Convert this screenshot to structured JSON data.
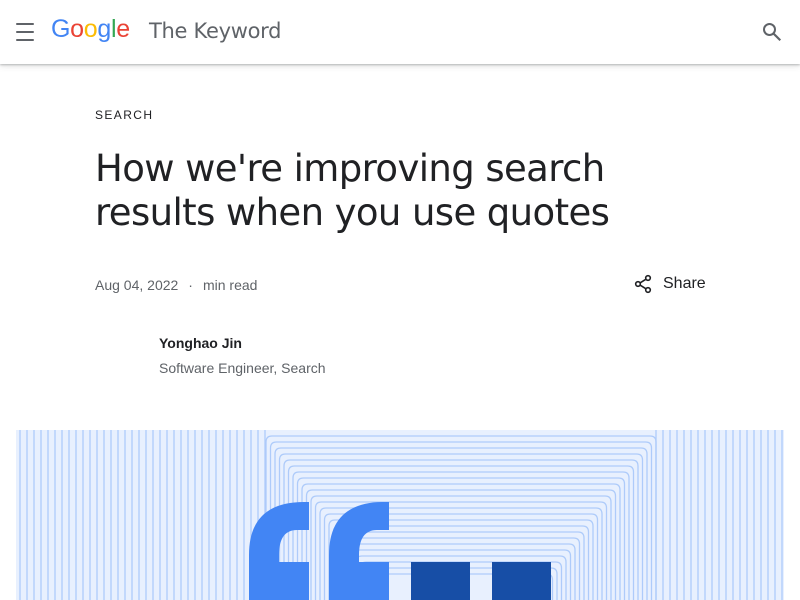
{
  "header": {
    "menu_icon": "menu-icon",
    "logo_letters": [
      {
        "char": "G",
        "color": "#4285F4"
      },
      {
        "char": "o",
        "color": "#EA4335"
      },
      {
        "char": "o",
        "color": "#FBBC05"
      },
      {
        "char": "g",
        "color": "#4285F4"
      },
      {
        "char": "l",
        "color": "#34A853"
      },
      {
        "char": "e",
        "color": "#EA4335"
      }
    ],
    "site_title": "The Keyword",
    "search_icon": "search-icon"
  },
  "article": {
    "category": "SEARCH",
    "title": "How we're improving search results when you use quotes",
    "date": "Aug 04, 2022",
    "separator": "·",
    "read_time": "min read",
    "share_label": "Share",
    "share_icon": "share-icon"
  },
  "author": {
    "name": "Yonghao Jin",
    "title": "Software Engineer, Search"
  },
  "hero": {
    "description_icon": "quotation-marks-illustration",
    "colors": {
      "background": "#e8f0fe",
      "lines": "#aecbfa",
      "quote_light": "#4285f4",
      "quote_dark": "#174ea6"
    }
  }
}
